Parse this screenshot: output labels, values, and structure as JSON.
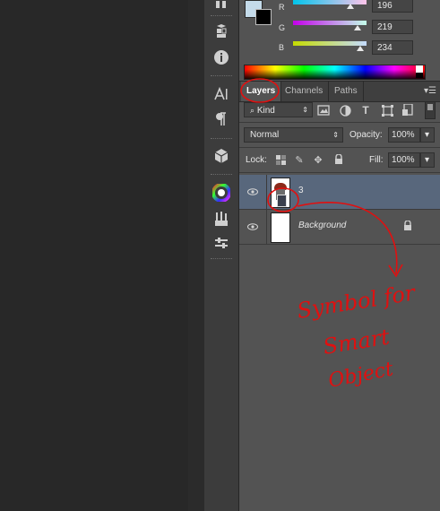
{
  "color_panel": {
    "channels": [
      {
        "label": "R",
        "value": "196",
        "fraction": 0.77,
        "gradient": [
          "#00c4ea",
          "#ffc4ea"
        ]
      },
      {
        "label": "G",
        "value": "219",
        "fraction": 0.86,
        "gradient": [
          "#c400ea",
          "#c4ffea"
        ]
      },
      {
        "label": "B",
        "value": "234",
        "fraction": 0.92,
        "gradient": [
          "#c4db00",
          "#c4dbff"
        ]
      }
    ],
    "foreground_color": "#c4dbea",
    "background_color": "#000000"
  },
  "tabs": [
    {
      "label": "Layers",
      "active": true
    },
    {
      "label": "Channels",
      "active": false
    },
    {
      "label": "Paths",
      "active": false
    }
  ],
  "filter": {
    "kind_label": "Kind",
    "icons": [
      "image-filter-icon",
      "adjustment-filter-icon",
      "type-filter-icon",
      "shape-filter-icon",
      "smart-object-filter-icon"
    ]
  },
  "blend": {
    "mode": "Normal",
    "opacity_label": "Opacity:",
    "opacity_value": "100%"
  },
  "lock": {
    "label": "Lock:",
    "fill_label": "Fill:",
    "fill_value": "100%"
  },
  "layers": [
    {
      "name": "3",
      "selected": true,
      "smart_object": true
    },
    {
      "name": "Background",
      "selected": false,
      "locked": true
    }
  ],
  "annotation": {
    "text_lines": [
      "Symbol for",
      "Smart",
      "Object"
    ],
    "color": "#e01010"
  },
  "tools": [
    "history-icon",
    "3d-layers-icon",
    "info-icon",
    "character-icon",
    "paragraph-icon",
    "3d-cube-icon",
    "color-wheel-icon",
    "brush-presets-icon",
    "tool-presets-icon"
  ]
}
